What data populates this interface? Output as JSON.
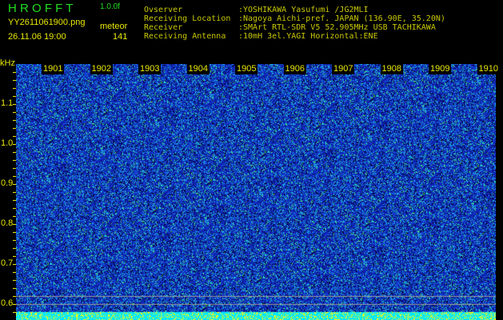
{
  "header": {
    "app_title": "H R O F F T",
    "version": "1.0.0f",
    "filename": "YY2611061900.png",
    "datetime": "26.11.06 19:00",
    "detection_label": "meteor",
    "detection_count": "141"
  },
  "info": [
    {
      "label": "Ovserver",
      "value": ":YOSHIKAWA Yasufumi /JG2MLI"
    },
    {
      "label": "Receiving Location",
      "value": ":Nagoya Aichi-pref. JAPAN (136.90E, 35.20N)"
    },
    {
      "label": "Receiver",
      "value": ":SMArt RTL-SDR V5 52.905MHz USB TACHIKAWA"
    },
    {
      "label": "Receiving Antenna",
      "value": ":10mH 3el.YAGI Horizontal:ENE"
    }
  ],
  "spectrogram": {
    "y_unit": "kHz",
    "y_ticks": [
      "1.1",
      "1.0",
      "0.9",
      "0.8",
      "0.7",
      "0.6"
    ],
    "time_labels": [
      "1901",
      "1902",
      "1903",
      "1904",
      "1905",
      "1906",
      "1907",
      "1908",
      "1909",
      "1910"
    ],
    "colors": {
      "background": "#0a1aa0",
      "noise_high": "#20e0e0",
      "peak": "#ffff00",
      "signal_bar": "#00e8ff"
    }
  }
}
